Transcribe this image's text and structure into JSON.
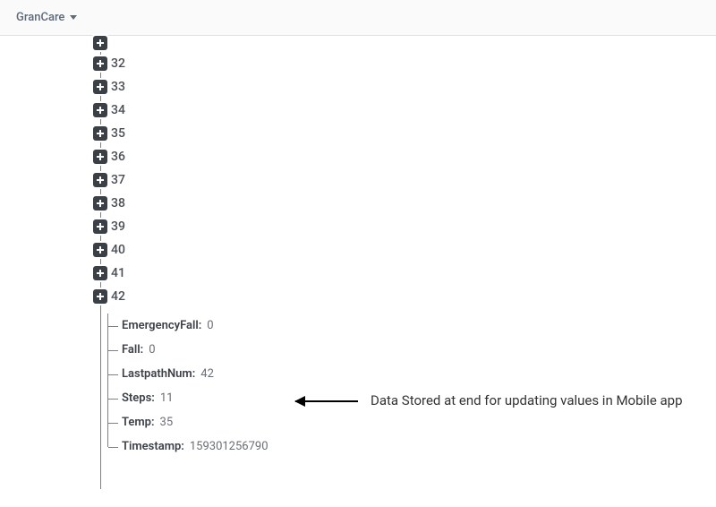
{
  "header": {
    "project_name": "GranCare"
  },
  "tree": {
    "collapsed_nodes": [
      {
        "label": "32"
      },
      {
        "label": "33"
      },
      {
        "label": "34"
      },
      {
        "label": "35"
      },
      {
        "label": "36"
      },
      {
        "label": "37"
      },
      {
        "label": "38"
      },
      {
        "label": "39"
      },
      {
        "label": "40"
      },
      {
        "label": "41"
      },
      {
        "label": "42"
      }
    ],
    "leaf_fields": [
      {
        "key": "EmergencyFall:",
        "value": "0"
      },
      {
        "key": "Fall:",
        "value": "0"
      },
      {
        "key": "LastpathNum:",
        "value": "42"
      },
      {
        "key": "Steps:",
        "value": "11"
      },
      {
        "key": "Temp:",
        "value": "35"
      },
      {
        "key": "Timestamp:",
        "value": "159301256790"
      }
    ]
  },
  "annotation": {
    "text": "Data Stored at end for updating values in Mobile app"
  }
}
